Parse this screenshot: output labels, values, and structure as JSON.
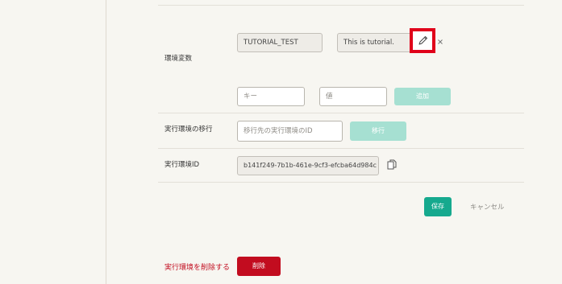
{
  "env_vars": {
    "label": "環境変数",
    "existing": {
      "key": "TUTORIAL_TEST",
      "value": "This is tutorial."
    },
    "new_key_placeholder": "キー",
    "new_value_placeholder": "値",
    "add_label": "追加",
    "edit_icon": "pencil-icon",
    "remove_icon": "close-icon"
  },
  "migration": {
    "label": "実行環境の移行",
    "placeholder": "移行先の実行環境のID",
    "button_label": "移行"
  },
  "env_id": {
    "label": "実行環境ID",
    "value": "b141f249-7b1b-461e-9cf3-efcba64d984c",
    "copy_icon": "copy-icon"
  },
  "actions": {
    "save_label": "保存",
    "cancel_label": "キャンセル"
  },
  "danger": {
    "label": "実行環境を削除する",
    "delete_label": "削除"
  },
  "colors": {
    "accent": "#16a98e",
    "accent_disabled": "#a6e0d2",
    "danger": "#c20c1f",
    "highlight": "#e0001a"
  }
}
